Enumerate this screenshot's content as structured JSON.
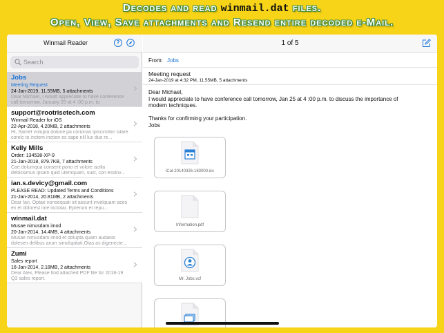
{
  "banner": {
    "line1_pre": "Decodes and read ",
    "line1_highlight": "winmail.dat",
    "line1_post": " files.",
    "line2": "Open, View, Save attachments and Resend entire decoded e-Mail."
  },
  "sidebar": {
    "title": "Winmail Reader",
    "help_glyph": "?",
    "search_placeholder": "Search",
    "items": [
      {
        "sender": "Jobs",
        "subject": "Meeting Request",
        "meta": "24-Jan-2019, 11.55MB, 5 attachments",
        "preview": "Dear Michael, I would appreciate to have conference call tomorrow, January 25 at 4 :00 p.m. to",
        "selected": true
      },
      {
        "sender": "support@rootrisetech.com",
        "subject": "Winmail Reader for iOS",
        "meta": "22-Apr-2018, 4.20MB, 2 attachments",
        "preview": "Hi, Samet volupta dolone pa corionas ipiscimillor sitare corelc to inctem inction es sape nill lux dus re..."
      },
      {
        "sender": "Kelly Mills",
        "subject": "Order: 134538-XP-9",
        "meta": "21-Jan-2018, 879.7KB, 7 attachments",
        "preview": "Cae dolumqua consent porio et volore acilla debissimus ipsam quid utemquam, sust, con essinv..."
      },
      {
        "sender": "ian.s.devicy@gmail.com",
        "subject": "PLEASE READ: Updated Terms and Conditions",
        "meta": "21-Jan-2014, 20.81MB, 2 attachments",
        "preview": "Dear Ian, Optae nonsequati sit assunt invelquam aces ex et dolorest ime inctotar. Eprerum et repu..."
      },
      {
        "sender": "winmail.dat",
        "subject": "Musae nimusdam imod",
        "meta": "20-Jan-2014, 14.4MB, 4 attachments",
        "preview": "Musae nimusdam imod et dolupta quam audanis dolesen delibus arum simolupitati.Otas as digenecte..."
      },
      {
        "sender": "Zumi",
        "subject": "Sales report",
        "meta": "16-Jan-2014, 2.18MB, 2 attachments",
        "preview": "Dear Alex, Please find attached PDF file for 2018-19 Q3 sales report."
      }
    ]
  },
  "detail": {
    "page_count": "1 of 5",
    "from_label": "From:",
    "from_name": "Jobs",
    "subject": "Meeting request",
    "subject_meta": "24-Jan-2019 at 4:32 PM, 11.55MB, 5 attachments",
    "body": {
      "greeting": "Dear Michael,",
      "line1": "I would appreciate to have conference call tomorrow, Jan 25 at 4 :00 p.m. to discuss the importance of",
      "line2": "modern techniques.",
      "thanks": "Thanks for confirming your participation.",
      "signoff": "Jobs"
    },
    "attachments": [
      {
        "name": "iCal-20140326-183000.ics",
        "icon": "calendar-file-icon"
      },
      {
        "name": "Information.pdf",
        "icon": "pdf-file-icon"
      },
      {
        "name": "Mr. Jobs.vcf",
        "icon": "contact-file-icon"
      },
      {
        "name": "",
        "icon": "image-file-icon"
      }
    ]
  },
  "colors": {
    "background": "#f7d417",
    "accent": "#1a73d9",
    "selected_row": "#d1d1d6"
  }
}
